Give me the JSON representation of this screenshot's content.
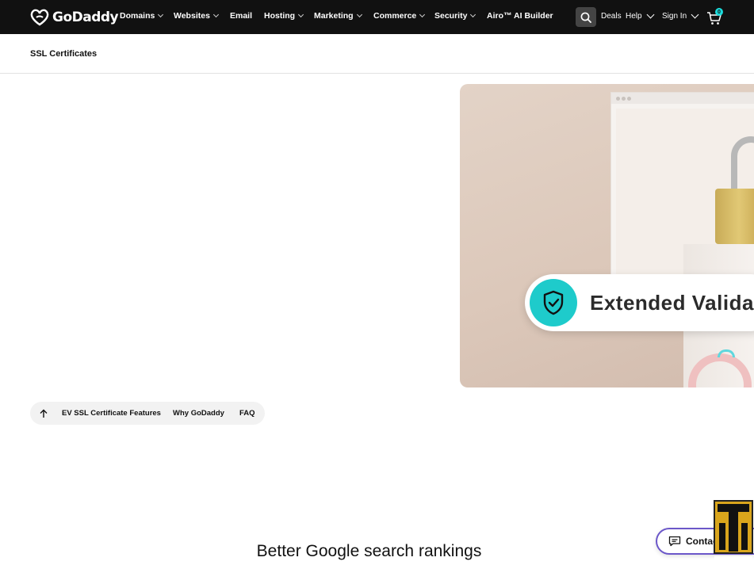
{
  "brand": {
    "name": "GoDaddy"
  },
  "nav": {
    "items": [
      {
        "label": "Domains",
        "has_menu": true
      },
      {
        "label": "Websites",
        "has_menu": true
      },
      {
        "label": "Email",
        "has_menu": false
      },
      {
        "label": "Hosting",
        "has_menu": true
      },
      {
        "label": "Marketing",
        "has_menu": true
      },
      {
        "label": "Commerce",
        "has_menu": true
      },
      {
        "label": "Security",
        "has_menu": true
      },
      {
        "label": "Airo™ AI Builder",
        "has_menu": false
      }
    ],
    "deals": "Deals",
    "help": "Help",
    "sign_in": "Sign In",
    "cart_count": "0"
  },
  "subheader": {
    "title": "SSL Certificates"
  },
  "hero": {
    "badge_text": "Extended Validat"
  },
  "anchor_nav": {
    "links": [
      "EV SSL Certificate Features",
      "Why GoDaddy",
      "FAQ"
    ]
  },
  "section": {
    "title": "Better Google search rankings"
  },
  "contact": {
    "label": "Contact Us"
  },
  "colors": {
    "topbar": "#111111",
    "accent_cyan": "#1ecbcb",
    "contact_border": "#6b57c9"
  }
}
